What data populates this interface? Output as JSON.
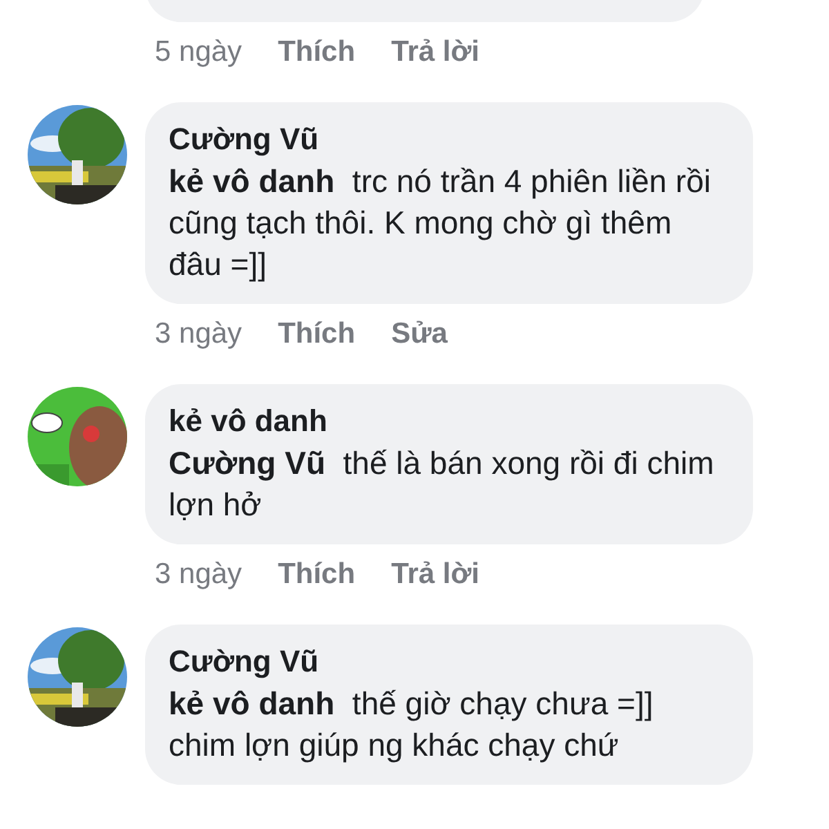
{
  "comments": [
    {
      "kind": "cut-off",
      "time": "5 ngày",
      "actions": [
        "Thích",
        "Trả lời"
      ]
    },
    {
      "kind": "comment",
      "author": "Cường Vũ",
      "mention": "kẻ vô danh",
      "text": "trc nó trần 4 phiên liền rồi cũng tạch thôi. K mong chờ gì thêm đâu  =]]",
      "time": "3 ngày",
      "actions": [
        "Thích",
        "Sửa"
      ]
    },
    {
      "kind": "comment",
      "avatar": {
        "kind": "drawing"
      },
      "author": "kẻ vô danh",
      "mention": "Cường Vũ",
      "text": "thế là bán xong rồi đi chim lợn hở",
      "time": "3 ngày",
      "actions": [
        "Thích",
        "Trả lời"
      ]
    },
    {
      "kind": "comment",
      "author": "Cường Vũ",
      "mention": "kẻ vô danh",
      "text": "thế giờ chạy chưa =]] chim lợn giúp ng khác chạy chứ"
    }
  ]
}
